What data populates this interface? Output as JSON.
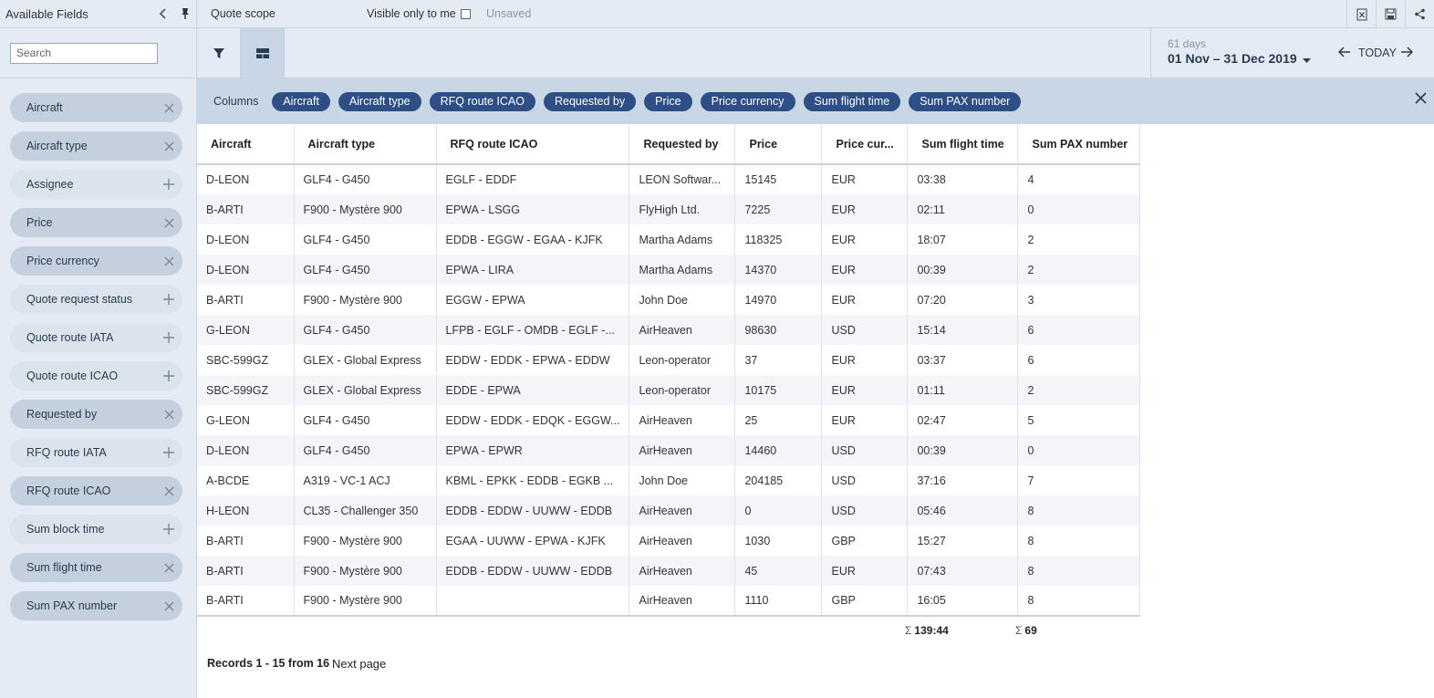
{
  "sidebar": {
    "title": "Available Fields",
    "search_placeholder": "Search",
    "fields": [
      {
        "label": "Aircraft",
        "active": true
      },
      {
        "label": "Aircraft type",
        "active": true
      },
      {
        "label": "Assignee",
        "active": false
      },
      {
        "label": "Price",
        "active": true
      },
      {
        "label": "Price currency",
        "active": true
      },
      {
        "label": "Quote request status",
        "active": false
      },
      {
        "label": "Quote route IATA",
        "active": false
      },
      {
        "label": "Quote route ICAO",
        "active": false
      },
      {
        "label": "Requested by",
        "active": true
      },
      {
        "label": "RFQ route IATA",
        "active": false
      },
      {
        "label": "RFQ route ICAO",
        "active": true
      },
      {
        "label": "Sum block time",
        "active": false
      },
      {
        "label": "Sum flight time",
        "active": true
      },
      {
        "label": "Sum PAX number",
        "active": true
      }
    ]
  },
  "topbar": {
    "scope": "Quote scope",
    "visible_only_label": "Visible only to me",
    "status": "Unsaved"
  },
  "toolbar": {
    "date_sub": "61 days",
    "date_range": "01 Nov – 31 Dec 2019",
    "today": "TODAY"
  },
  "columns_bar": {
    "label": "Columns",
    "chips": [
      "Aircraft",
      "Aircraft type",
      "RFQ route ICAO",
      "Requested by",
      "Price",
      "Price currency",
      "Sum flight time",
      "Sum PAX number"
    ]
  },
  "table": {
    "headers": [
      "Aircraft",
      "Aircraft type",
      "RFQ route ICAO",
      "Requested by",
      "Price",
      "Price cur...",
      "Sum flight time",
      "Sum PAX number"
    ],
    "rows": [
      [
        "D-LEON",
        "GLF4 - G450",
        "EGLF - EDDF",
        "LEON Softwar...",
        "15145",
        "EUR",
        "03:38",
        "4"
      ],
      [
        "B-ARTI",
        "F900 - Mystère 900",
        "EPWA - LSGG",
        "FlyHigh Ltd.",
        "7225",
        "EUR",
        "02:11",
        "0"
      ],
      [
        "D-LEON",
        "GLF4 - G450",
        "EDDB - EGGW - EGAA - KJFK",
        "Martha Adams",
        "118325",
        "EUR",
        "18:07",
        "2"
      ],
      [
        "D-LEON",
        "GLF4 - G450",
        "EPWA - LIRA",
        "Martha Adams",
        "14370",
        "EUR",
        "00:39",
        "2"
      ],
      [
        "B-ARTI",
        "F900 - Mystère 900",
        "EGGW - EPWA",
        "John Doe",
        "14970",
        "EUR",
        "07:20",
        "3"
      ],
      [
        "G-LEON",
        "GLF4 - G450",
        "LFPB - EGLF - OMDB - EGLF -...",
        "AirHeaven",
        "98630",
        "USD",
        "15:14",
        "6"
      ],
      [
        "SBC-599GZ",
        "GLEX - Global Express",
        "EDDW - EDDK - EPWA - EDDW",
        "Leon-operator",
        "37",
        "EUR",
        "03:37",
        "6"
      ],
      [
        "SBC-599GZ",
        "GLEX - Global Express",
        "EDDE - EPWA",
        "Leon-operator",
        "10175",
        "EUR",
        "01:11",
        "2"
      ],
      [
        "G-LEON",
        "GLF4 - G450",
        "EDDW - EDDK - EDQK - EGGW...",
        "AirHeaven",
        "25",
        "EUR",
        "02:47",
        "5"
      ],
      [
        "D-LEON",
        "GLF4 - G450",
        "EPWA - EPWR",
        "AirHeaven",
        "14460",
        "USD",
        "00:39",
        "0"
      ],
      [
        "A-BCDE",
        "A319 - VC-1 ACJ",
        "KBML - EPKK - EDDB - EGKB ...",
        "John Doe",
        "204185",
        "USD",
        "37:16",
        "7"
      ],
      [
        "H-LEON",
        "CL35 - Challenger 350",
        "EDDB - EDDW - UUWW - EDDB",
        "AirHeaven",
        "0",
        "USD",
        "05:46",
        "8"
      ],
      [
        "B-ARTI",
        "F900 - Mystère 900",
        "EGAA - UUWW - EPWA - KJFK",
        "AirHeaven",
        "1030",
        "GBP",
        "15:27",
        "8"
      ],
      [
        "B-ARTI",
        "F900 - Mystère 900",
        "EDDB - EDDW - UUWW - EDDB",
        "AirHeaven",
        "45",
        "EUR",
        "07:43",
        "8"
      ],
      [
        "B-ARTI",
        "F900 - Mystère 900",
        "",
        "AirHeaven",
        "1110",
        "GBP",
        "16:05",
        "8"
      ]
    ],
    "sum_symbol": "Σ",
    "sum_flight_time": "139:44",
    "sum_pax": "69"
  },
  "footer": {
    "records": "Records 1 - 15 from 16",
    "next_page": "Next page"
  }
}
